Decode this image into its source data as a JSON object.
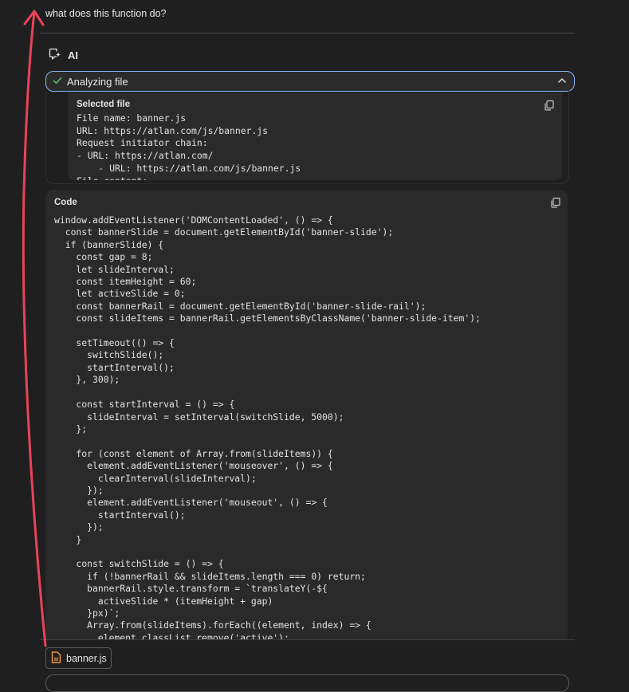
{
  "question": "what does this function do?",
  "ai": {
    "label": "AI",
    "icon": "ai-sparkle-icon"
  },
  "analyzing": {
    "label": "Analyzing file",
    "status_icon": "check-icon",
    "toggle_icon": "chevron-up-icon",
    "status_color": "#5bb974"
  },
  "selected_file": {
    "title": "Selected file",
    "body": "File name: banner.js\nURL: https://atlan.com/js/banner.js\nRequest initiator chain:\n- URL: https://atlan.com/\n    - URL: https://atlan.com/js/banner.js\nFile content:",
    "copy_icon": "copy-icon"
  },
  "code": {
    "title": "Code",
    "copy_icon": "copy-icon",
    "body": "window.addEventListener('DOMContentLoaded', () => {\n  const bannerSlide = document.getElementById('banner-slide');\n  if (bannerSlide) {\n    const gap = 8;\n    let slideInterval;\n    const itemHeight = 60;\n    let activeSlide = 0;\n    const bannerRail = document.getElementById('banner-slide-rail');\n    const slideItems = bannerRail.getElementsByClassName('banner-slide-item');\n\n    setTimeout(() => {\n      switchSlide();\n      startInterval();\n    }, 300);\n\n    const startInterval = () => {\n      slideInterval = setInterval(switchSlide, 5000);\n    };\n\n    for (const element of Array.from(slideItems)) {\n      element.addEventListener('mouseover', () => {\n        clearInterval(slideInterval);\n      });\n      element.addEventListener('mouseout', () => {\n        startInterval();\n      });\n    }\n\n    const switchSlide = () => {\n      if (!bannerRail && slideItems.length === 0) return;\n      bannerRail.style.transform = `translateY(-${\n        activeSlide * (itemHeight + gap)\n      }px)`;\n      Array.from(slideItems).forEach((element, index) => {\n        element.classList.remove('active');"
  },
  "attachment": {
    "name": "banner.js",
    "icon": "file-icon",
    "icon_color": "#f29a4a"
  },
  "annotation": {
    "color": "#e8435a"
  }
}
